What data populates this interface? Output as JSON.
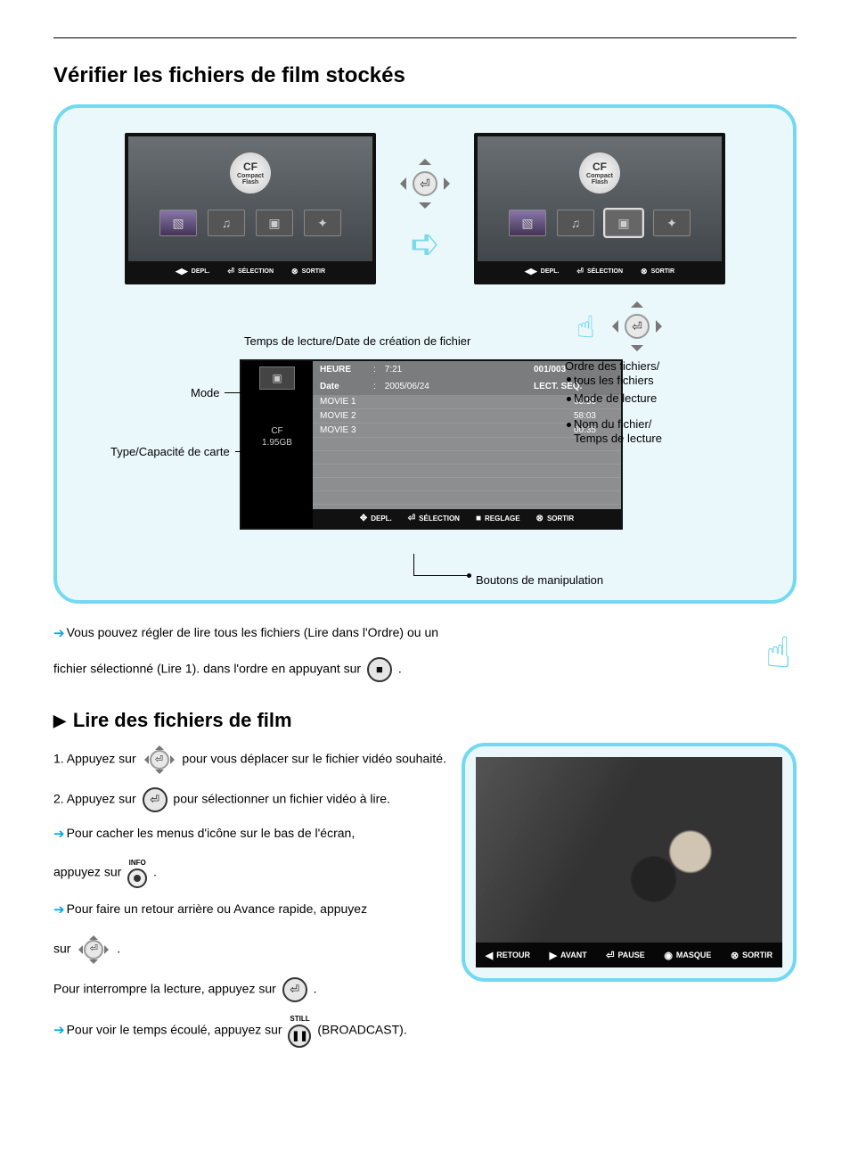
{
  "title_main": "Vérifier les fichiers de film stockés",
  "title_sub": "Lire des fichiers de film",
  "cf_badge": {
    "big": "CF",
    "small1": "Compact",
    "small2": "Flash"
  },
  "tv_footer": {
    "depl": "DEPL.",
    "selection": "SÉLECTION",
    "sortir": "SORTIR"
  },
  "caption_playtime": "Temps de lecture/Date de création de fichier",
  "labels": {
    "mode": "Mode",
    "card": "Type/Capacité de carte",
    "order1": "Ordre des fichiers/",
    "order2": "tous les fichiers",
    "playmode": "Mode de lecture",
    "filename1": "Nom du fichier/",
    "filename2": "Temps de lecture",
    "buttons": "Boutons de manipulation"
  },
  "browser": {
    "heure_lbl": "HEURE",
    "heure_val": "7:21",
    "date_lbl": "Date",
    "date_val": "2005/06/24",
    "count": "001/003",
    "lect": "LECT. SEQ.",
    "card_type": "CF",
    "card_cap": "1.95GB",
    "rows": [
      {
        "name": "MOVIE 1",
        "time": "63:58"
      },
      {
        "name": "MOVIE 2",
        "time": "58:03"
      },
      {
        "name": "MOVIE 3",
        "time": "00:35"
      }
    ],
    "foot": {
      "depl": "DEPL.",
      "selection": "SÉLECTION",
      "reglage": "REGLAGE",
      "sortir": "SORTIR"
    }
  },
  "para1a": "Vous pouvez régler de lire tous les fichiers (Lire dans l'Ordre) ou un",
  "para1b": "fichier sélectionné (Lire 1). dans l'ordre en appuyant sur",
  "steps": {
    "s1a": "1. Appuyez sur",
    "s1b": "pour vous déplacer sur le fichier vidéo souhaité.",
    "s2a": "2. Appuyez sur",
    "s2b": "pour sélectionner un fichier vidéo à lire.",
    "s3a": "Pour cacher les menus d'icône sur le bas de l'écran,",
    "s3b": "appuyez sur",
    "s4a": "Pour faire un retour arrière ou Avance rapide, appuyez",
    "s4b": "sur",
    "s5": "Pour interrompre la lecture, appuyez sur",
    "s6a": "Pour voir le temps écoulé, appuyez sur",
    "s6b": "(BROADCAST)."
  },
  "info_label": "INFO",
  "still_label": "STILL",
  "pause_glyph": "❚❚",
  "video_bar": {
    "retour": "RETOUR",
    "avant": "AVANT",
    "pause": "PAUSE",
    "masque": "MASQUE",
    "sortir": "SORTIR"
  }
}
